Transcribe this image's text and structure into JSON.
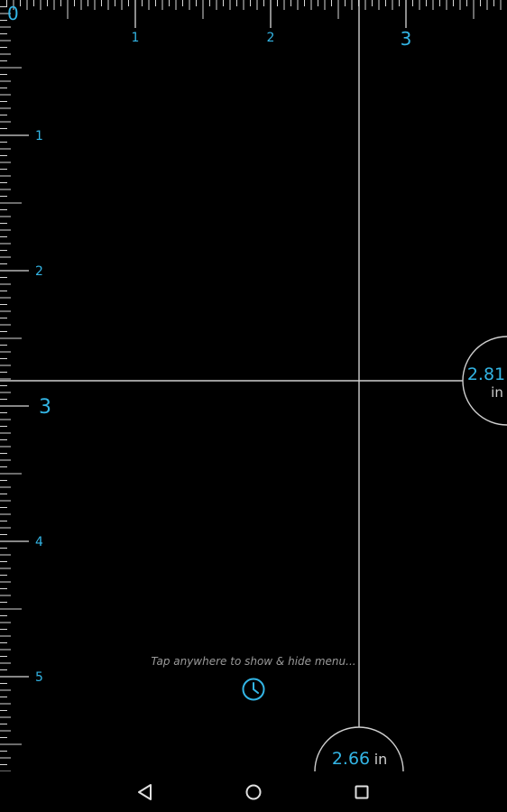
{
  "ruler": {
    "origin_label": "0",
    "unit": "in",
    "top_labels": [
      "1",
      "2",
      "3"
    ],
    "left_labels": [
      "1",
      "2",
      "3",
      "4",
      "5"
    ]
  },
  "measurements": {
    "horizontal": {
      "value": "2.81",
      "unit": "in"
    },
    "vertical": {
      "value": "2.66",
      "unit": "in"
    }
  },
  "hint": {
    "text": "Tap anywhere to show & hide menu..."
  },
  "icons": {
    "history": "clock-icon",
    "back": "back-triangle-icon",
    "home": "home-circle-icon",
    "recents": "recents-square-icon"
  },
  "colors": {
    "accent": "#33b5e5",
    "line": "#cfcfcf",
    "background": "#000000"
  }
}
